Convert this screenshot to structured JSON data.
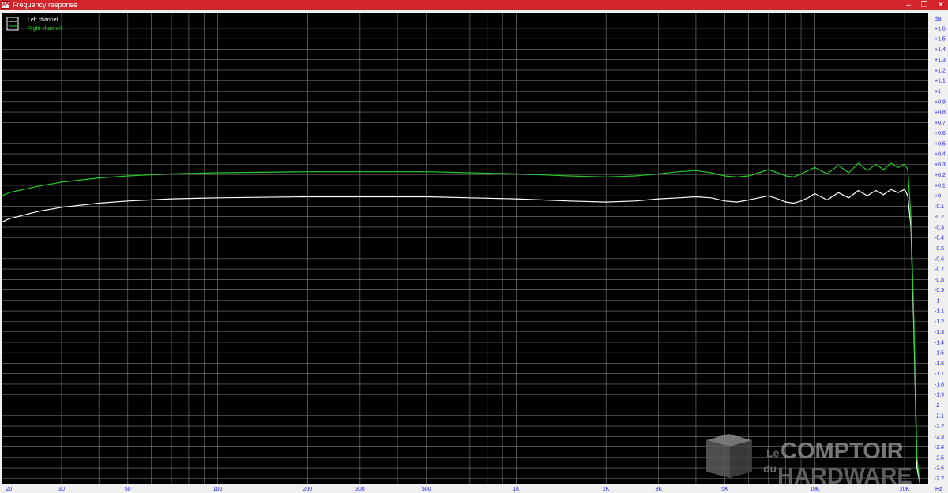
{
  "window": {
    "title": "Frequency response",
    "minimize_glyph": "–",
    "maximize_glyph": "❐",
    "close_glyph": "✕",
    "icon": "audio-analyzer-app-icon"
  },
  "colors": {
    "titlebar": "#d4252a",
    "plot_background": "#000000",
    "grid": "#808080",
    "tick_labels": "#1a1aff",
    "left_channel": "#ffffff",
    "right_channel": "#22cc22"
  },
  "watermark": {
    "le": "Le",
    "du": "du",
    "line1": "COMPTOIR",
    "line2": "HARDWARE",
    "logo": "cube-logo-icon"
  },
  "chart_data": {
    "type": "line",
    "x_scale": "log",
    "xlim": [
      19,
      24000
    ],
    "ylim": [
      -2.75,
      1.75
    ],
    "grid": true,
    "legend_position": "top-left",
    "xunit": "Hz",
    "yunit": "dB",
    "x_ticks": [
      {
        "value": 20,
        "label": "20"
      },
      {
        "value": 30,
        "label": "30"
      },
      {
        "value": 50,
        "label": "50"
      },
      {
        "value": 100,
        "label": "100"
      },
      {
        "value": 200,
        "label": "200"
      },
      {
        "value": 300,
        "label": "300"
      },
      {
        "value": 500,
        "label": "500"
      },
      {
        "value": 1000,
        "label": "1K"
      },
      {
        "value": 2000,
        "label": "2K"
      },
      {
        "value": 3000,
        "label": "3K"
      },
      {
        "value": 5000,
        "label": "5K"
      },
      {
        "value": 10000,
        "label": "10K"
      },
      {
        "value": 20000,
        "label": "20K"
      }
    ],
    "x_grid_values": [
      20,
      30,
      40,
      50,
      60,
      70,
      80,
      90,
      100,
      200,
      300,
      400,
      500,
      600,
      700,
      800,
      900,
      1000,
      2000,
      3000,
      4000,
      5000,
      6000,
      7000,
      8000,
      9000,
      10000,
      20000
    ],
    "y_ticks": [
      {
        "value": 1.6,
        "label": "+1.6"
      },
      {
        "value": 1.5,
        "label": "+1.5"
      },
      {
        "value": 1.4,
        "label": "+1.4"
      },
      {
        "value": 1.3,
        "label": "+1.3"
      },
      {
        "value": 1.2,
        "label": "+1.2"
      },
      {
        "value": 1.1,
        "label": "+1.1"
      },
      {
        "value": 1.0,
        "label": "+1"
      },
      {
        "value": 0.9,
        "label": "+0.9"
      },
      {
        "value": 0.8,
        "label": "+0.8"
      },
      {
        "value": 0.7,
        "label": "+0.7"
      },
      {
        "value": 0.6,
        "label": "+0.6"
      },
      {
        "value": 0.5,
        "label": "+0.5"
      },
      {
        "value": 0.4,
        "label": "+0.4"
      },
      {
        "value": 0.3,
        "label": "+0.3"
      },
      {
        "value": 0.2,
        "label": "+0.2"
      },
      {
        "value": 0.1,
        "label": "+0.1"
      },
      {
        "value": 0.0,
        "label": "+0"
      },
      {
        "value": -0.1,
        "label": "-0.1"
      },
      {
        "value": -0.2,
        "label": "-0.2"
      },
      {
        "value": -0.3,
        "label": "-0.3"
      },
      {
        "value": -0.4,
        "label": "-0.4"
      },
      {
        "value": -0.5,
        "label": "-0.5"
      },
      {
        "value": -0.6,
        "label": "-0.6"
      },
      {
        "value": -0.7,
        "label": "-0.7"
      },
      {
        "value": -0.8,
        "label": "-0.8"
      },
      {
        "value": -0.9,
        "label": "-0.9"
      },
      {
        "value": -1.0,
        "label": "-1"
      },
      {
        "value": -1.1,
        "label": "-1.1"
      },
      {
        "value": -1.2,
        "label": "-1.2"
      },
      {
        "value": -1.3,
        "label": "-1.3"
      },
      {
        "value": -1.4,
        "label": "-1.4"
      },
      {
        "value": -1.5,
        "label": "-1.5"
      },
      {
        "value": -1.6,
        "label": "-1.6"
      },
      {
        "value": -1.7,
        "label": "-1.7"
      },
      {
        "value": -1.8,
        "label": "-1.8"
      },
      {
        "value": -1.9,
        "label": "-1.9"
      },
      {
        "value": -2.0,
        "label": "-2"
      },
      {
        "value": -2.1,
        "label": "-2.1"
      },
      {
        "value": -2.2,
        "label": "-2.2"
      },
      {
        "value": -2.3,
        "label": "-2.3"
      },
      {
        "value": -2.4,
        "label": "-2.4"
      },
      {
        "value": -2.5,
        "label": "-2.5"
      },
      {
        "value": -2.6,
        "label": "-2.6"
      },
      {
        "value": -2.7,
        "label": "-2.7"
      }
    ],
    "series": [
      {
        "name": "Left channel",
        "color": "#ffffff",
        "x": [
          19,
          20,
          25,
          30,
          40,
          50,
          70,
          100,
          200,
          300,
          500,
          700,
          1000,
          1500,
          2000,
          2500,
          3000,
          3500,
          4000,
          4500,
          5000,
          5500,
          6000,
          6500,
          7000,
          7500,
          8000,
          8500,
          9000,
          9500,
          10000,
          11000,
          12000,
          13000,
          14000,
          15000,
          16000,
          17000,
          18000,
          19000,
          20000,
          20500,
          21000,
          21500,
          22000,
          22500
        ],
        "values": [
          -0.25,
          -0.22,
          -0.15,
          -0.11,
          -0.07,
          -0.05,
          -0.03,
          -0.02,
          -0.01,
          -0.01,
          -0.01,
          -0.02,
          -0.03,
          -0.05,
          -0.06,
          -0.05,
          -0.03,
          -0.02,
          -0.01,
          -0.02,
          -0.05,
          -0.06,
          -0.04,
          -0.02,
          0.0,
          -0.03,
          -0.06,
          -0.07,
          -0.05,
          -0.02,
          0.02,
          -0.04,
          0.03,
          -0.02,
          0.05,
          0.0,
          0.05,
          0.01,
          0.06,
          0.03,
          0.06,
          0.0,
          -0.3,
          -1.3,
          -2.6,
          -2.75
        ]
      },
      {
        "name": "Right channel",
        "color": "#22cc22",
        "x": [
          19,
          20,
          25,
          30,
          40,
          50,
          70,
          100,
          200,
          300,
          500,
          700,
          1000,
          1500,
          2000,
          2500,
          3000,
          3500,
          4000,
          4500,
          5000,
          5500,
          6000,
          6500,
          7000,
          7500,
          8000,
          8500,
          9000,
          9500,
          10000,
          11000,
          12000,
          13000,
          14000,
          15000,
          16000,
          17000,
          18000,
          19000,
          20000,
          20500,
          21000,
          21500,
          22000,
          22500
        ],
        "values": [
          0.0,
          0.03,
          0.09,
          0.13,
          0.17,
          0.19,
          0.21,
          0.22,
          0.23,
          0.23,
          0.23,
          0.22,
          0.21,
          0.19,
          0.18,
          0.19,
          0.21,
          0.23,
          0.24,
          0.22,
          0.19,
          0.18,
          0.19,
          0.22,
          0.25,
          0.22,
          0.19,
          0.18,
          0.21,
          0.24,
          0.27,
          0.21,
          0.29,
          0.22,
          0.31,
          0.24,
          0.3,
          0.25,
          0.31,
          0.27,
          0.3,
          0.25,
          -0.2,
          -1.2,
          -2.5,
          -2.75
        ]
      }
    ]
  }
}
